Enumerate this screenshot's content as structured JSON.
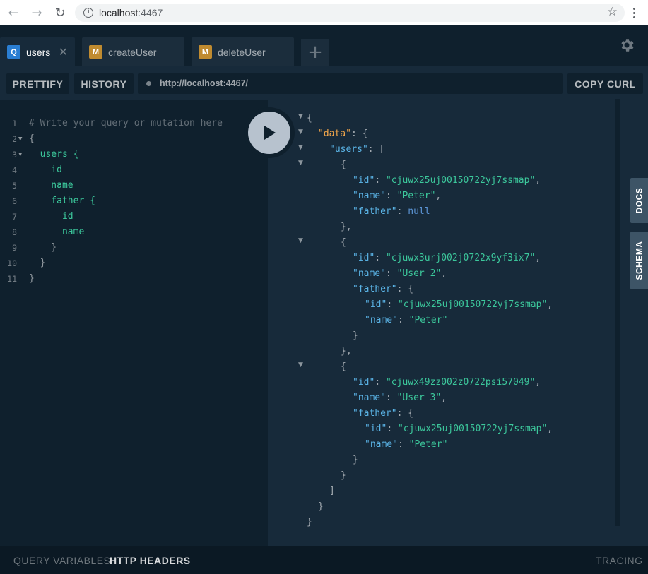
{
  "browser": {
    "url_host": "localhost",
    "url_port": ":4467",
    "back_icon": "←",
    "forward_icon": "→",
    "reload_icon": "↻",
    "info_icon": "i",
    "star_icon": "☆"
  },
  "tabs": [
    {
      "badge": "Q",
      "label": "users",
      "close": "✕"
    },
    {
      "badge": "M",
      "label": "createUser"
    },
    {
      "badge": "M",
      "label": "deleteUser"
    }
  ],
  "tab_add": "+",
  "toolbar": {
    "prettify": "PRETTIFY",
    "history": "HISTORY",
    "endpoint": "http://localhost:4467/",
    "copy_curl": "COPY CURL"
  },
  "editor": {
    "lines": [
      {
        "n": "1",
        "text": "# Write your query or mutation here"
      },
      {
        "n": "2",
        "text": "{"
      },
      {
        "n": "3",
        "text": "  users {"
      },
      {
        "n": "4",
        "text": "    id"
      },
      {
        "n": "5",
        "text": "    name"
      },
      {
        "n": "6",
        "text": "    father {"
      },
      {
        "n": "7",
        "text": "      id"
      },
      {
        "n": "8",
        "text": "      name"
      },
      {
        "n": "9",
        "text": "    }"
      },
      {
        "n": "10",
        "text": "  }"
      },
      {
        "n": "11",
        "text": "}"
      }
    ]
  },
  "result": {
    "open_brace": "{",
    "close_brace": "}",
    "data_key": "\"data\"",
    "users_key": "\"users\"",
    "id_key": "\"id\"",
    "name_key": "\"name\"",
    "father_key": "\"father\"",
    "null": "null",
    "users": [
      {
        "id": "\"cjuwx25uj00150722yj7ssmap\"",
        "name": "\"Peter\""
      },
      {
        "id": "\"cjuwx3urj002j0722x9yf3ix7\"",
        "name": "\"User 2\"",
        "father_id": "\"cjuwx25uj00150722yj7ssmap\"",
        "father_name": "\"Peter\""
      },
      {
        "id": "\"cjuwx49zz002z0722psi57049\"",
        "name": "\"User 3\"",
        "father_id": "\"cjuwx25uj00150722yj7ssmap\"",
        "father_name": "\"Peter\""
      }
    ]
  },
  "side_tabs": {
    "docs": "DOCS",
    "schema": "SCHEMA"
  },
  "bottom": {
    "query_variables": "QUERY VARIABLES",
    "http_headers": "HTTP HEADERS",
    "tracing": "TRACING"
  }
}
